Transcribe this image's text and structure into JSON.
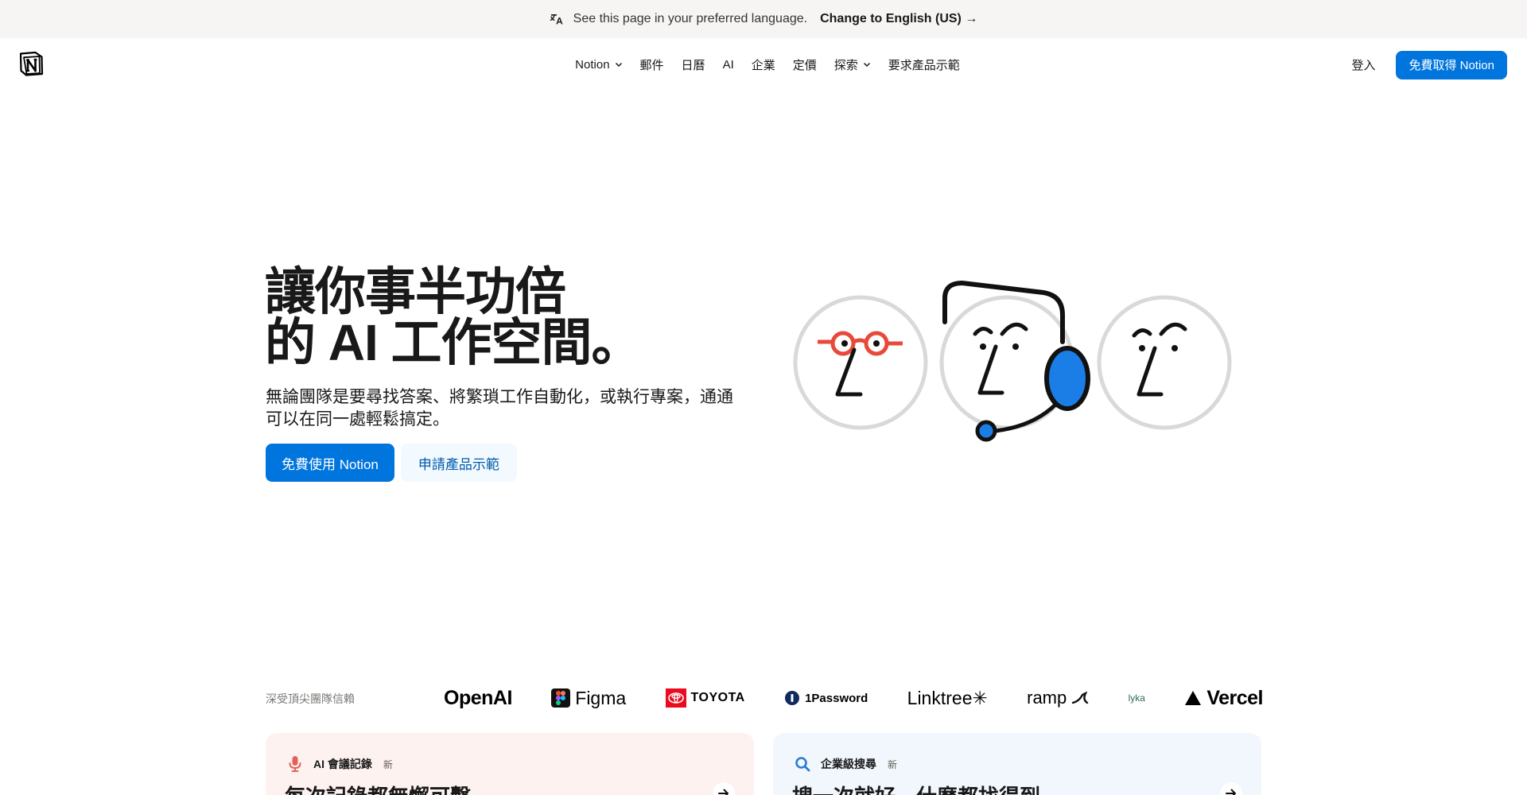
{
  "banner": {
    "message": "See this page in your preferred language.",
    "link": "Change to English (US) →",
    "icon": "translate-icon"
  },
  "nav": {
    "logo_icon": "notion-logo",
    "items": [
      {
        "label": "Notion",
        "dropdown": true
      },
      {
        "label": "郵件"
      },
      {
        "label": "日曆"
      },
      {
        "label": "AI"
      },
      {
        "label": "企業"
      },
      {
        "label": "定價"
      },
      {
        "label": "探索",
        "dropdown": true
      },
      {
        "label": "要求產品示範"
      }
    ],
    "login": "登入",
    "cta": "免費取得 Notion"
  },
  "hero": {
    "title_line1": "讓你事半功倍",
    "title_line2": "的 AI 工作空間。",
    "subtitle": "無論團隊是要尋找答案、將繁瑣工作自動化，或執行專案，通通可以在同一處輕鬆搞定。",
    "primary_button": "免費使用 Notion",
    "secondary_button": "申請產品示範"
  },
  "trust": {
    "label": "深受頂尖團隊信賴",
    "logos": [
      "OpenAI",
      "Figma",
      "TOYOTA",
      "1Password",
      "Linktree✳",
      "ramp",
      "lyka",
      "Vercel"
    ]
  },
  "cards": [
    {
      "tag": "AI 會議記錄",
      "badge": "新",
      "title": "每次記錄都無懈可擊",
      "icon": "microphone-icon",
      "accent": "#e16259"
    },
    {
      "tag": "企業級搜尋",
      "badge": "新",
      "title": "搜一次就好，什麼都找得到",
      "icon": "search-icon",
      "accent": "#2a7cd6"
    }
  ],
  "colors": {
    "primary": "#0075de",
    "banner_bg": "#f6f5f4"
  }
}
